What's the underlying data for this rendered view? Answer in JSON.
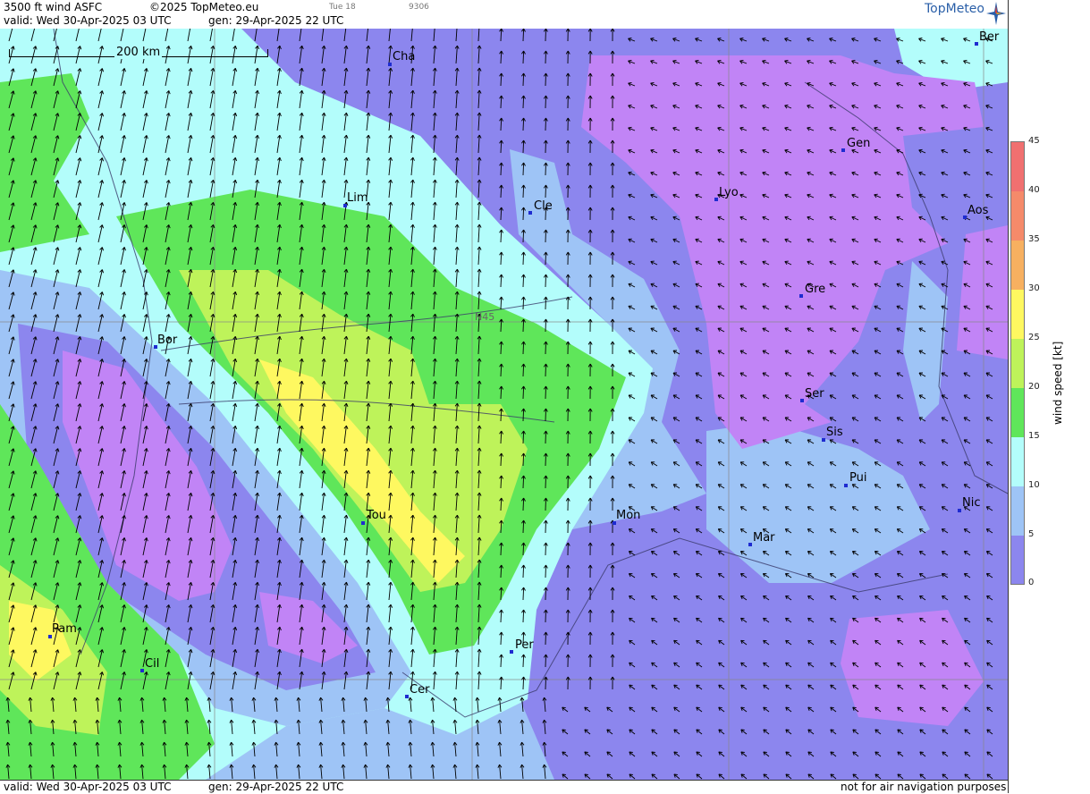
{
  "header": {
    "title": "3500 ft wind ASFC",
    "copyright": "©2025 TopMeteo.eu",
    "day_tag": "Tue 18",
    "code": "9306",
    "valid": "valid:  Wed  30-Apr-2025  03 UTC",
    "generated": "gen: 29-Apr-2025 22 UTC",
    "logo": "TopMeteo"
  },
  "scale_bar": {
    "label": "200 km"
  },
  "grid_label": "N45",
  "cities": [
    {
      "name": "Cha"
    },
    {
      "name": "Ber"
    },
    {
      "name": "Gen"
    },
    {
      "name": "Lyo"
    },
    {
      "name": "Lim"
    },
    {
      "name": "Cle"
    },
    {
      "name": "Aos"
    },
    {
      "name": "Gre"
    },
    {
      "name": "Bor"
    },
    {
      "name": "Ser"
    },
    {
      "name": "Sis"
    },
    {
      "name": "Pui"
    },
    {
      "name": "Nic"
    },
    {
      "name": "Tou"
    },
    {
      "name": "Mon"
    },
    {
      "name": "Mar"
    },
    {
      "name": "Pam"
    },
    {
      "name": "Cil"
    },
    {
      "name": "Per"
    },
    {
      "name": "Cer"
    }
  ],
  "legend": {
    "ticks": [
      "45",
      "40",
      "35",
      "30",
      "25",
      "20",
      "15",
      "10",
      "5",
      "0"
    ],
    "unit": "wind  speed  [kt]",
    "colors": [
      "#f07070",
      "#f58a6a",
      "#f7b060",
      "#fef860",
      "#bef35a",
      "#5fe65a",
      "#b3fdfb",
      "#9ec4f6",
      "#8c86ee",
      "#c184f6"
    ]
  },
  "footer": {
    "valid": "valid:  Wed  30-Apr-2025  03 UTC",
    "generated": "gen: 29-Apr-2025 22 UTC",
    "disclaimer": "not for air navigation purposes"
  }
}
